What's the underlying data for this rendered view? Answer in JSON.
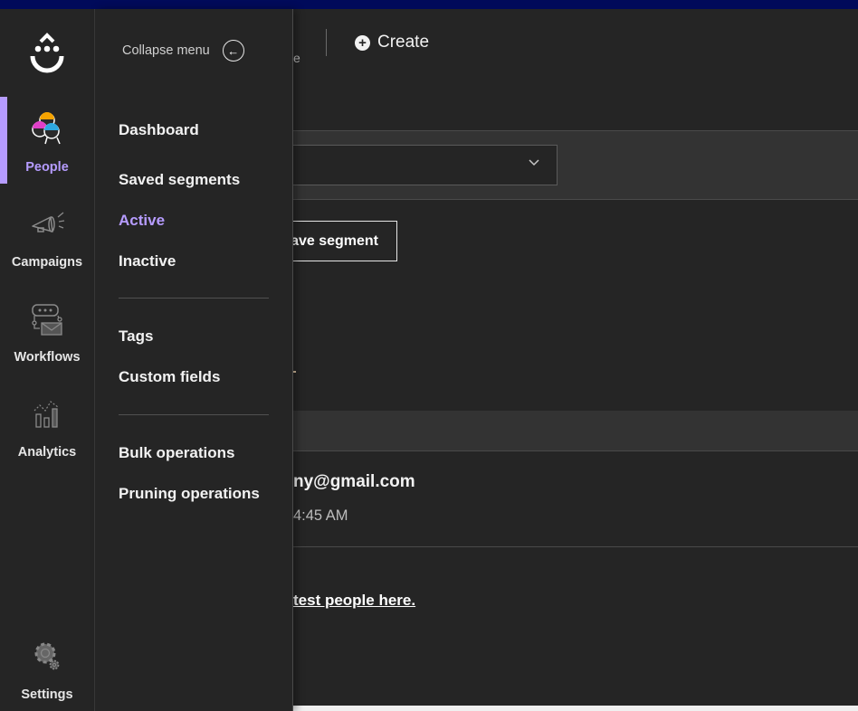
{
  "app": {
    "brand_color": "#b69cff",
    "topbar_color": "#000a5a"
  },
  "rail": {
    "logo": "smiley-drop-logo",
    "items": [
      {
        "label": "People",
        "icon": "people-icon",
        "active": true
      },
      {
        "label": "Campaigns",
        "icon": "megaphone-icon",
        "active": false
      },
      {
        "label": "Workflows",
        "icon": "workflow-icon",
        "active": false
      },
      {
        "label": "Analytics",
        "icon": "analytics-icon",
        "active": false
      }
    ],
    "settings": {
      "label": "Settings",
      "icon": "gear-icon"
    }
  },
  "flyout": {
    "collapse_label": "Collapse menu",
    "collapse_icon": "arrow-left-circle-icon",
    "groups": [
      [
        {
          "label": "Dashboard",
          "active": false
        },
        {
          "label": "Saved segments",
          "active": false
        },
        {
          "label": "Active",
          "active": true
        },
        {
          "label": "Inactive",
          "active": false
        }
      ],
      [
        {
          "label": "Tags",
          "active": false
        },
        {
          "label": "Custom fields",
          "active": false
        }
      ],
      [
        {
          "label": "Bulk operations",
          "active": false
        },
        {
          "label": "Pruning operations",
          "active": false
        }
      ]
    ]
  },
  "main": {
    "partial_subtitle": "e",
    "create_label": "Create",
    "filter_dropdown": {
      "value": "",
      "icon": "chevron-down-icon"
    },
    "save_segment_label": "ave segment",
    "rows": [
      {
        "email": "ny@gmail.com",
        "time": "4:45 AM"
      }
    ],
    "test_people_link": "test people here."
  }
}
